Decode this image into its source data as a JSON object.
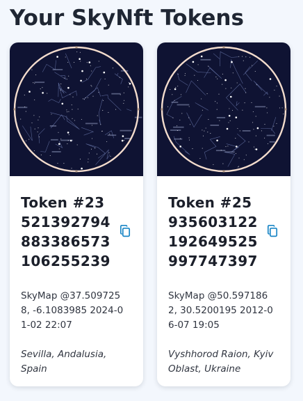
{
  "page": {
    "title": "Your SkyNft Tokens"
  },
  "colors": {
    "background": "#f3f7fd",
    "card": "#ffffff",
    "sky": "#0f1333",
    "ring": "#f3dccd",
    "accent": "#1a86c6"
  },
  "cards": [
    {
      "token_lines": [
        "Token #23",
        "521392794",
        "883386573",
        "106255239"
      ],
      "copy_icon": "copy-icon",
      "skymap_lines": [
        "SkyMap @37.509725",
        "8, -6.1083985 2024-0",
        "1-02 22:07"
      ],
      "location_lines": [
        "Sevilla, Andalusia,",
        "Spain"
      ]
    },
    {
      "token_lines": [
        "Token #25",
        "935603122",
        "192649525",
        "997747397"
      ],
      "copy_icon": "copy-icon",
      "skymap_lines": [
        "SkyMap @50.597186",
        "2, 30.5200195 2012-0",
        "6-07 19:05"
      ],
      "location_lines": [
        "Vyshhorod Raion, Kyiv",
        "Oblast, Ukraine"
      ]
    }
  ]
}
